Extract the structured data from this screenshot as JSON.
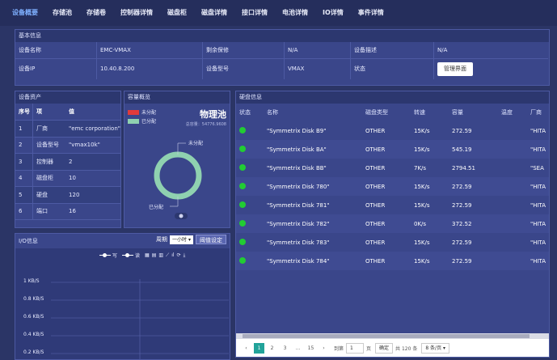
{
  "nav": {
    "tabs": [
      "设备概要",
      "存储池",
      "存储卷",
      "控制器详情",
      "磁盘柜",
      "磁盘详情",
      "接口详情",
      "电池详情",
      "IO详情",
      "事件详情"
    ]
  },
  "basic_info": {
    "title": "基本信息",
    "row1": [
      "设备名称",
      "EMC-VMAX",
      "剩余保修",
      "N/A",
      "设备描述",
      "N/A"
    ],
    "row2": [
      "设备IP",
      "10.40.8.200",
      "设备型号",
      "VMAX",
      "状态"
    ],
    "mgmt_button": "管理界面"
  },
  "assets": {
    "title": "设备资产",
    "headers": [
      "序号",
      "项",
      "值"
    ],
    "rows": [
      {
        "idx": "1",
        "key": "厂商",
        "value": "\"emc corporation\""
      },
      {
        "idx": "2",
        "key": "设备型号",
        "value": "\"vmax10k\""
      },
      {
        "idx": "3",
        "key": "控制器",
        "value": "2"
      },
      {
        "idx": "4",
        "key": "磁盘柜",
        "value": "10"
      },
      {
        "idx": "5",
        "key": "硬盘",
        "value": "120"
      },
      {
        "idx": "6",
        "key": "端口",
        "value": "16"
      }
    ]
  },
  "capacity": {
    "title": "容量概览",
    "legend_unalloc": "未分配",
    "legend_alloc": "已分配",
    "pool_title": "物理池",
    "pool_capacity": "总容量：54776.9608",
    "label_unalloc": "未分配",
    "label_alloc": "已分配",
    "colors": {
      "unalloc": "#e03b3b",
      "alloc": "#8fd1b0"
    }
  },
  "disks": {
    "title": "硬盘信息",
    "headers": [
      "状态",
      "名称",
      "磁盘类型",
      "转速",
      "容量",
      "温度",
      "厂商"
    ],
    "rows": [
      {
        "name": "\"Symmetrix Disk B9\"",
        "type": "OTHER",
        "rpm": "15K/s",
        "cap": "272.59",
        "temp": "",
        "vendor": "\"HITA"
      },
      {
        "name": "\"Symmetrix Disk BA\"",
        "type": "OTHER",
        "rpm": "15K/s",
        "cap": "545.19",
        "temp": "",
        "vendor": "\"HITA"
      },
      {
        "name": "\"Symmetrix Disk BB\"",
        "type": "OTHER",
        "rpm": "7K/s",
        "cap": "2794.51",
        "temp": "",
        "vendor": "\"SEA"
      },
      {
        "name": "\"Symmetrix Disk 780\"",
        "type": "OTHER",
        "rpm": "15K/s",
        "cap": "272.59",
        "temp": "",
        "vendor": "\"HITA"
      },
      {
        "name": "\"Symmetrix Disk 781\"",
        "type": "OTHER",
        "rpm": "15K/s",
        "cap": "272.59",
        "temp": "",
        "vendor": "\"HITA"
      },
      {
        "name": "\"Symmetrix Disk 782\"",
        "type": "OTHER",
        "rpm": "0K/s",
        "cap": "372.52",
        "temp": "",
        "vendor": "\"HITA"
      },
      {
        "name": "\"Symmetrix Disk 783\"",
        "type": "OTHER",
        "rpm": "15K/s",
        "cap": "272.59",
        "temp": "",
        "vendor": "\"HITA"
      },
      {
        "name": "\"Symmetrix Disk 784\"",
        "type": "OTHER",
        "rpm": "15K/s",
        "cap": "272.59",
        "temp": "",
        "vendor": "\"HITA"
      }
    ],
    "pager": {
      "pages": [
        "1",
        "2",
        "3",
        "...",
        "15"
      ],
      "goto_label": "到第",
      "goto_value": "1",
      "page_suffix": "页",
      "confirm": "确定",
      "total": "共 120 条",
      "page_size": "8 条/页"
    }
  },
  "io": {
    "title": "I/O信息",
    "period_label": "周期",
    "period_value": "一小时",
    "threshold_button": "阈值设定",
    "legend_write": "写",
    "legend_read": "读",
    "y_ticks": [
      "1 KB/S",
      "0.8 KB/S",
      "0.6 KB/S",
      "0.4 KB/S",
      "0.2 KB/S"
    ]
  }
}
